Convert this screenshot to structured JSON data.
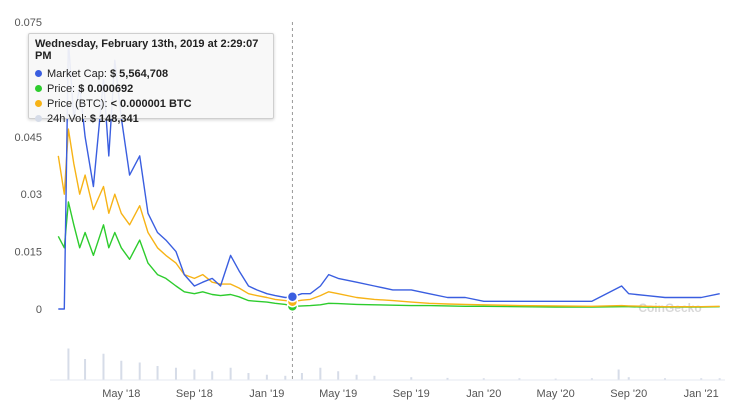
{
  "chart_data": {
    "type": "line",
    "x_ticks": [
      "May '18",
      "Sep '18",
      "Jan '19",
      "May '19",
      "Sep '19",
      "Jan '20",
      "May '20",
      "Sep '20",
      "Jan '21"
    ],
    "y_ticks": [
      "0",
      "0.015",
      "0.03",
      "0.045",
      "0.075"
    ],
    "ylim": [
      0,
      0.075
    ],
    "grid": false,
    "watermark": "CoinGecko",
    "colors": {
      "market_cap": "#3a5ee0",
      "price": "#2dcc2d",
      "price_btc": "#f7b316",
      "volume": "#d6dce8"
    },
    "series": [
      {
        "name": "Price",
        "x": [
          "2018-01-15",
          "2018-01-25",
          "2018-02-01",
          "2018-02-10",
          "2018-02-20",
          "2018-03-01",
          "2018-03-15",
          "2018-04-01",
          "2018-04-10",
          "2018-04-20",
          "2018-05-01",
          "2018-05-15",
          "2018-06-01",
          "2018-06-15",
          "2018-07-01",
          "2018-07-15",
          "2018-08-01",
          "2018-08-15",
          "2018-09-01",
          "2018-09-15",
          "2018-10-01",
          "2018-10-15",
          "2018-11-01",
          "2018-11-15",
          "2018-12-01",
          "2018-12-15",
          "2019-01-01",
          "2019-01-15",
          "2019-02-01",
          "2019-02-13",
          "2019-03-01",
          "2019-03-15",
          "2019-04-01",
          "2019-04-15",
          "2019-05-01",
          "2019-06-01",
          "2019-07-01",
          "2019-08-01",
          "2019-09-01",
          "2019-10-01",
          "2019-11-01",
          "2019-12-01",
          "2020-01-01",
          "2020-03-01",
          "2020-05-01",
          "2020-07-01",
          "2020-08-20",
          "2020-09-01",
          "2020-10-01",
          "2020-11-01",
          "2020-12-01",
          "2021-01-01",
          "2021-02-01"
        ],
        "values": [
          0.019,
          0.016,
          0.028,
          0.022,
          0.016,
          0.02,
          0.014,
          0.022,
          0.016,
          0.02,
          0.016,
          0.013,
          0.018,
          0.012,
          0.009,
          0.008,
          0.006,
          0.0045,
          0.004,
          0.0045,
          0.0038,
          0.0035,
          0.0038,
          0.0032,
          0.0022,
          0.002,
          0.0018,
          0.0015,
          0.0012,
          0.000692,
          0.0008,
          0.0009,
          0.0011,
          0.0015,
          0.0014,
          0.0012,
          0.0011,
          0.001,
          0.0009,
          0.0009,
          0.0008,
          0.0007,
          0.0007,
          0.0006,
          0.0005,
          0.0005,
          0.0006,
          0.0006,
          0.0005,
          0.0005,
          0.0005,
          0.0005,
          0.0006
        ]
      },
      {
        "name": "Price (BTC)",
        "x": [
          "2018-01-15",
          "2018-01-25",
          "2018-02-01",
          "2018-02-10",
          "2018-02-20",
          "2018-03-01",
          "2018-03-15",
          "2018-04-01",
          "2018-04-10",
          "2018-04-20",
          "2018-05-01",
          "2018-05-15",
          "2018-06-01",
          "2018-06-15",
          "2018-07-01",
          "2018-07-15",
          "2018-08-01",
          "2018-08-15",
          "2018-09-01",
          "2018-09-15",
          "2018-10-01",
          "2018-10-15",
          "2018-11-01",
          "2018-11-15",
          "2018-12-01",
          "2018-12-15",
          "2019-01-01",
          "2019-01-15",
          "2019-02-01",
          "2019-02-13",
          "2019-03-01",
          "2019-03-15",
          "2019-04-01",
          "2019-04-15",
          "2019-05-01",
          "2019-06-01",
          "2019-07-01",
          "2019-08-01",
          "2019-09-01",
          "2019-10-01",
          "2019-11-01",
          "2019-12-01",
          "2020-01-01",
          "2020-03-01",
          "2020-05-01",
          "2020-07-01",
          "2020-08-20",
          "2020-09-01",
          "2020-10-01",
          "2020-11-01",
          "2020-12-01",
          "2021-01-01",
          "2021-02-01"
        ],
        "values": [
          0.04,
          0.03,
          0.047,
          0.038,
          0.03,
          0.035,
          0.026,
          0.032,
          0.025,
          0.03,
          0.025,
          0.022,
          0.027,
          0.02,
          0.016,
          0.014,
          0.012,
          0.009,
          0.008,
          0.009,
          0.007,
          0.0065,
          0.0065,
          0.0055,
          0.004,
          0.0035,
          0.003,
          0.0025,
          0.0022,
          0.0019,
          0.0023,
          0.0025,
          0.0035,
          0.0045,
          0.004,
          0.003,
          0.0025,
          0.0022,
          0.0018,
          0.0015,
          0.0013,
          0.0012,
          0.0011,
          0.0009,
          0.0008,
          0.0007,
          0.0009,
          0.0008,
          0.0007,
          0.0006,
          0.0006,
          0.0006,
          0.0007
        ]
      },
      {
        "name": "Market Cap",
        "x": [
          "2018-01-15",
          "2018-01-25",
          "2018-02-01",
          "2018-02-10",
          "2018-02-20",
          "2018-03-01",
          "2018-03-15",
          "2018-04-01",
          "2018-04-10",
          "2018-04-20",
          "2018-05-01",
          "2018-05-15",
          "2018-06-01",
          "2018-06-15",
          "2018-07-01",
          "2018-07-15",
          "2018-08-01",
          "2018-08-15",
          "2018-09-01",
          "2018-09-15",
          "2018-10-01",
          "2018-10-15",
          "2018-11-01",
          "2018-11-15",
          "2018-12-01",
          "2018-12-15",
          "2019-01-01",
          "2019-01-15",
          "2019-02-01",
          "2019-02-13",
          "2019-03-01",
          "2019-03-15",
          "2019-04-01",
          "2019-04-15",
          "2019-05-01",
          "2019-06-01",
          "2019-07-01",
          "2019-08-01",
          "2019-09-01",
          "2019-10-01",
          "2019-11-01",
          "2019-12-01",
          "2020-01-01",
          "2020-03-01",
          "2020-05-01",
          "2020-07-01",
          "2020-08-20",
          "2020-09-01",
          "2020-10-01",
          "2020-11-01",
          "2020-12-01",
          "2021-01-01",
          "2021-02-01"
        ],
        "values": [
          0.0,
          0.0,
          0.07,
          0.05,
          0.058,
          0.045,
          0.032,
          0.06,
          0.04,
          0.065,
          0.05,
          0.035,
          0.04,
          0.025,
          0.02,
          0.018,
          0.015,
          0.009,
          0.006,
          0.007,
          0.008,
          0.006,
          0.014,
          0.01,
          0.006,
          0.005,
          0.004,
          0.0035,
          0.003,
          0.0032,
          0.004,
          0.004,
          0.006,
          0.009,
          0.008,
          0.007,
          0.006,
          0.005,
          0.005,
          0.004,
          0.003,
          0.003,
          0.002,
          0.002,
          0.002,
          0.002,
          0.006,
          0.004,
          0.0035,
          0.003,
          0.003,
          0.003,
          0.004
        ]
      },
      {
        "name": "24h Vol",
        "x": [
          "2018-01-15",
          "2018-02-01",
          "2018-03-01",
          "2018-04-01",
          "2018-05-01",
          "2018-06-01",
          "2018-07-01",
          "2018-08-01",
          "2018-09-01",
          "2018-10-01",
          "2018-11-01",
          "2018-12-01",
          "2019-01-01",
          "2019-02-01",
          "2019-03-01",
          "2019-04-01",
          "2019-05-01",
          "2019-06-01",
          "2019-07-01",
          "2019-09-01",
          "2019-11-01",
          "2020-01-01",
          "2020-03-01",
          "2020-05-01",
          "2020-07-01",
          "2020-08-15",
          "2020-09-01",
          "2020-11-01",
          "2021-01-01",
          "2021-02-01"
        ],
        "values": [
          0.0,
          0.9,
          0.6,
          0.75,
          0.55,
          0.5,
          0.4,
          0.35,
          0.3,
          0.25,
          0.35,
          0.2,
          0.15,
          0.12,
          0.2,
          0.35,
          0.25,
          0.15,
          0.12,
          0.08,
          0.06,
          0.05,
          0.05,
          0.04,
          0.05,
          0.3,
          0.08,
          0.05,
          0.05,
          0.05
        ]
      }
    ]
  },
  "tooltip": {
    "title": "Wednesday, February 13th, 2019 at 2:29:07 PM",
    "rows": [
      {
        "label": "Market Cap:",
        "value": "$ 5,564,708",
        "color": "#3a5ee0"
      },
      {
        "label": "Price:",
        "value": "$ 0.000692",
        "color": "#2dcc2d"
      },
      {
        "label": "Price (BTC):",
        "value": "< 0.000001 BTC",
        "color": "#f7b316"
      },
      {
        "label": "24h Vol:",
        "value": "$ 148,341",
        "color": "#d6dce8"
      }
    ]
  },
  "hover_date": "2019-02-13"
}
